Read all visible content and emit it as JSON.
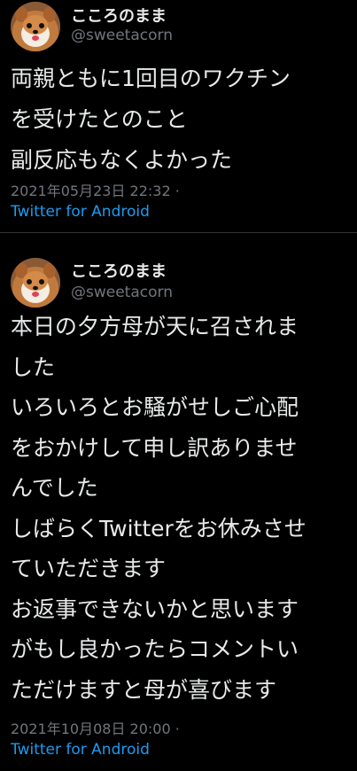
{
  "tweets": [
    {
      "author": {
        "display_name": "こころのまま",
        "handle": "@sweetacorn",
        "avatar_icon": "pomeranian-dog-avatar"
      },
      "text_lines": [
        "両親ともに1回目のワクチン",
        "を受けたとのこと",
        "副反応もなくよかった"
      ],
      "timestamp": "2021年05月23日 22:32 ·",
      "source": "Twitter for Android"
    },
    {
      "author": {
        "display_name": "こころのまま",
        "handle": "@sweetacorn",
        "avatar_icon": "pomeranian-dog-avatar"
      },
      "text_lines": [
        "本日の夕方母が天に召されま",
        "した",
        "いろいろとお騒がせしご心配",
        "をおかけして申し訳ありませ",
        "んでした",
        "しばらくTwitterをお休みさせ",
        "ていただきます",
        "お返事できないかと思います",
        "がもし良かったらコメントい",
        "ただけますと母が喜びます"
      ],
      "timestamp": "2021年10月08日 20:00 ·",
      "source": "Twitter for Android"
    }
  ],
  "colors": {
    "background": "#000000",
    "primary_text": "#e7e9ea",
    "secondary_text": "#71767b",
    "link": "#1d9bf0",
    "divider": "#2f3336"
  }
}
